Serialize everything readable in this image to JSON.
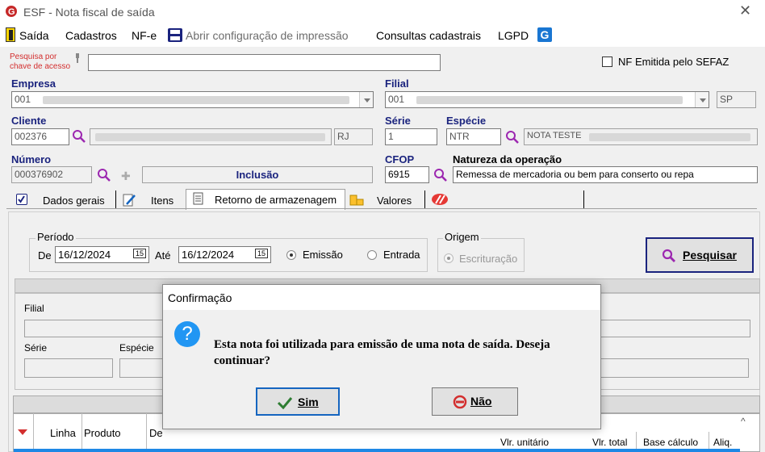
{
  "window": {
    "title": "ESF - Nota fiscal de saída"
  },
  "menu": {
    "saida": "Saída",
    "cadastros": "Cadastros",
    "nfe": "NF-e",
    "abrir_config": "Abrir configuração de impressão",
    "consultas": "Consultas cadastrais",
    "lgpd": "LGPD"
  },
  "search": {
    "label_line1": "Pesquisa por",
    "label_line2": "chave de acesso",
    "value": "",
    "nf_emitida_label": "NF Emitida pelo SEFAZ",
    "nf_emitida_checked": false
  },
  "empresa": {
    "label": "Empresa",
    "code": "001"
  },
  "filial": {
    "label": "Filial",
    "code": "001",
    "uf": "SP"
  },
  "cliente": {
    "label": "Cliente",
    "code": "002376",
    "uf": "RJ"
  },
  "serie": {
    "label": "Série",
    "value": "1"
  },
  "especie": {
    "label": "Espécie",
    "code": "NTR",
    "description": "NOTA TESTE"
  },
  "numero": {
    "label": "Número",
    "value": "000376902",
    "mode": "Inclusão"
  },
  "cfop": {
    "label": "CFOP",
    "value": "6915"
  },
  "natureza": {
    "label": "Natureza da operação",
    "value": "Remessa de mercadoria ou bem para conserto ou repa"
  },
  "tabs": {
    "dados_gerais": "Dados gerais",
    "itens": "Itens",
    "retorno": "Retorno de armazenagem",
    "valores": "Valores"
  },
  "periodo": {
    "legend": "Período",
    "de_label": "De",
    "de_value": "16/12/2024",
    "ate_label": "Até",
    "ate_value": "16/12/2024",
    "emissao_label": "Emissão",
    "entrada_label": "Entrada",
    "selected": "Emissão",
    "cal_glyph": "15"
  },
  "origem": {
    "legend": "Origem",
    "escrituracao_label": "Escrituração"
  },
  "pesquisar": {
    "label": "Pesquisar"
  },
  "filters": {
    "filial": "Filial",
    "serie": "Série",
    "especie": "Espécie"
  },
  "grid": {
    "columns": [
      "Linha",
      "Produto",
      "De",
      "Vlr. unitário",
      "Vlr. total",
      "Base cálculo",
      "Aliq."
    ]
  },
  "dialog": {
    "title": "Confirmação",
    "message": "Esta nota foi utilizada para emissão de uma nota de saída. Deseja continuar?",
    "yes": "Sim",
    "no": "Não"
  },
  "colors": {
    "accent": "#1a237e",
    "purple_icon": "#9c27b0",
    "red": "#c62828"
  }
}
